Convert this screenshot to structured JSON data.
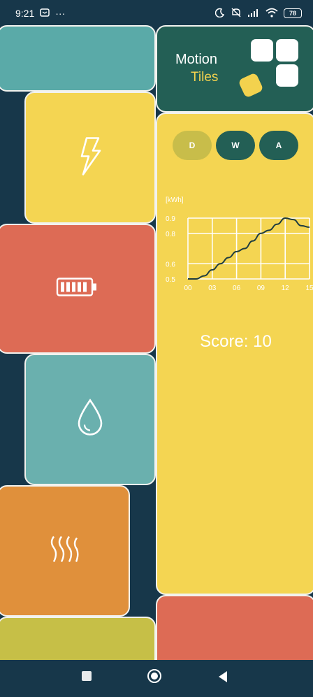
{
  "status_bar": {
    "time": "9:21",
    "dots": "···",
    "battery": "78",
    "icons": [
      "notification-icon",
      "moon-icon",
      "mute-icon",
      "signal-icon",
      "wifi-icon",
      "battery-icon"
    ]
  },
  "header": {
    "line1": "Motion",
    "line2": "Tiles"
  },
  "tiles": [
    {
      "name": "power-tile",
      "icon": "lightning-icon",
      "color": "#f4d552"
    },
    {
      "name": "battery-tile",
      "icon": "battery-icon",
      "color": "#dd6b55"
    },
    {
      "name": "water-tile",
      "icon": "water-drop-icon",
      "color": "#6ab0ae"
    },
    {
      "name": "heat-tile",
      "icon": "heat-icon",
      "color": "#e0903b"
    }
  ],
  "colors": {
    "background": "#17374a",
    "teal": "#5aaaa8",
    "header_green": "#235f55",
    "yellow": "#f4d552",
    "red": "#dd6b55",
    "orange": "#e0903b",
    "olive": "#c6bf47",
    "pill_active": "#c8bd4a",
    "pill_dark": "#235f55"
  },
  "period_tabs": [
    {
      "label": "D",
      "active": true
    },
    {
      "label": "W",
      "active": false
    },
    {
      "label": "A",
      "active": false
    }
  ],
  "chart_data": {
    "type": "line",
    "ylabel": "[kWh]",
    "x": [
      "00",
      "03",
      "06",
      "09",
      "12",
      "15"
    ],
    "series": [
      {
        "x": [
          0,
          1,
          2,
          3,
          4,
          5,
          6,
          7,
          8,
          9,
          10,
          11,
          12,
          13,
          14,
          15
        ],
        "values": [
          0.5,
          0.5,
          0.52,
          0.56,
          0.6,
          0.64,
          0.68,
          0.7,
          0.75,
          0.8,
          0.82,
          0.86,
          0.9,
          0.89,
          0.85,
          0.84
        ]
      }
    ],
    "yticks": [
      "0.5",
      "0.6",
      "0.8",
      "0.9"
    ],
    "ylim": [
      0.5,
      0.9
    ],
    "xlim": [
      0,
      15
    ],
    "grid": true
  },
  "score": {
    "text": "Score: 10"
  }
}
